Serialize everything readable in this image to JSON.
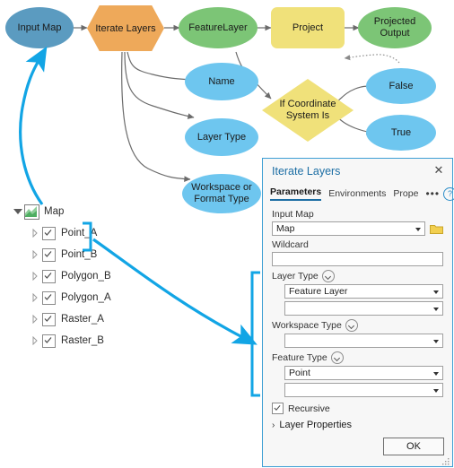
{
  "model": {
    "nodes": [
      {
        "id": "input-map",
        "label": "Input Map",
        "shape": "ellipse",
        "color": "#5b9bc0"
      },
      {
        "id": "iterate-layers",
        "label": "Iterate Layers",
        "shape": "hexagon",
        "color": "#eea95a"
      },
      {
        "id": "featurelayer",
        "label": "FeatureLayer",
        "shape": "ellipse",
        "color": "#7cc576"
      },
      {
        "id": "project",
        "label": "Project",
        "shape": "rounded-rect",
        "color": "#f0e17a"
      },
      {
        "id": "projected-output",
        "label": "Projected Output",
        "shape": "ellipse",
        "color": "#7cc576"
      },
      {
        "id": "name",
        "label": "Name",
        "shape": "ellipse",
        "color": "#6ec6ef"
      },
      {
        "id": "layer-type",
        "label": "Layer Type",
        "shape": "ellipse",
        "color": "#6ec6ef"
      },
      {
        "id": "workspace-or-format-type",
        "label": "Workspace or Format Type",
        "shape": "ellipse",
        "color": "#6ec6ef"
      },
      {
        "id": "if-coordinate-system-is",
        "label": "If Coordinate System Is",
        "shape": "diamond",
        "color": "#f0e17a"
      },
      {
        "id": "false",
        "label": "False",
        "shape": "ellipse",
        "color": "#6ec6ef"
      },
      {
        "id": "true",
        "label": "True",
        "shape": "ellipse",
        "color": "#6ec6ef"
      }
    ],
    "connector_color": "#6b6b6b",
    "annotation_color": "#12a5e5"
  },
  "contents": {
    "root": {
      "label": "Map",
      "icon": "map-icon",
      "expanded": true
    },
    "layers": [
      {
        "label": "Point_A",
        "checked": true
      },
      {
        "label": "Point_B",
        "checked": true
      },
      {
        "label": "Polygon_B",
        "checked": true
      },
      {
        "label": "Polygon_A",
        "checked": true
      },
      {
        "label": "Raster_A",
        "checked": true
      },
      {
        "label": "Raster_B",
        "checked": true
      }
    ]
  },
  "dialog": {
    "title": "Iterate Layers",
    "close_label": "✕",
    "tabs": [
      {
        "label": "Parameters",
        "active": true
      },
      {
        "label": "Environments",
        "active": false
      },
      {
        "label": "Prope",
        "active": false
      }
    ],
    "overflow_label": "•••",
    "help_label": "?",
    "fields": {
      "input_map": {
        "label": "Input Map",
        "value": "Map",
        "browse_icon": "folder-icon"
      },
      "wildcard": {
        "label": "Wildcard",
        "value": ""
      },
      "layer_type": {
        "label": "Layer Type",
        "value": "Feature Layer",
        "extra_value": ""
      },
      "workspace_type": {
        "label": "Workspace Type",
        "value": "",
        "extra_value": ""
      },
      "feature_type": {
        "label": "Feature Type",
        "value": "Point",
        "extra_value": ""
      }
    },
    "recursive": {
      "label": "Recursive",
      "checked": true
    },
    "layer_properties": {
      "label": "Layer Properties",
      "expanded": false,
      "arrow": "›"
    },
    "ok_label": "OK",
    "accent_color": "#1c6ea4"
  }
}
